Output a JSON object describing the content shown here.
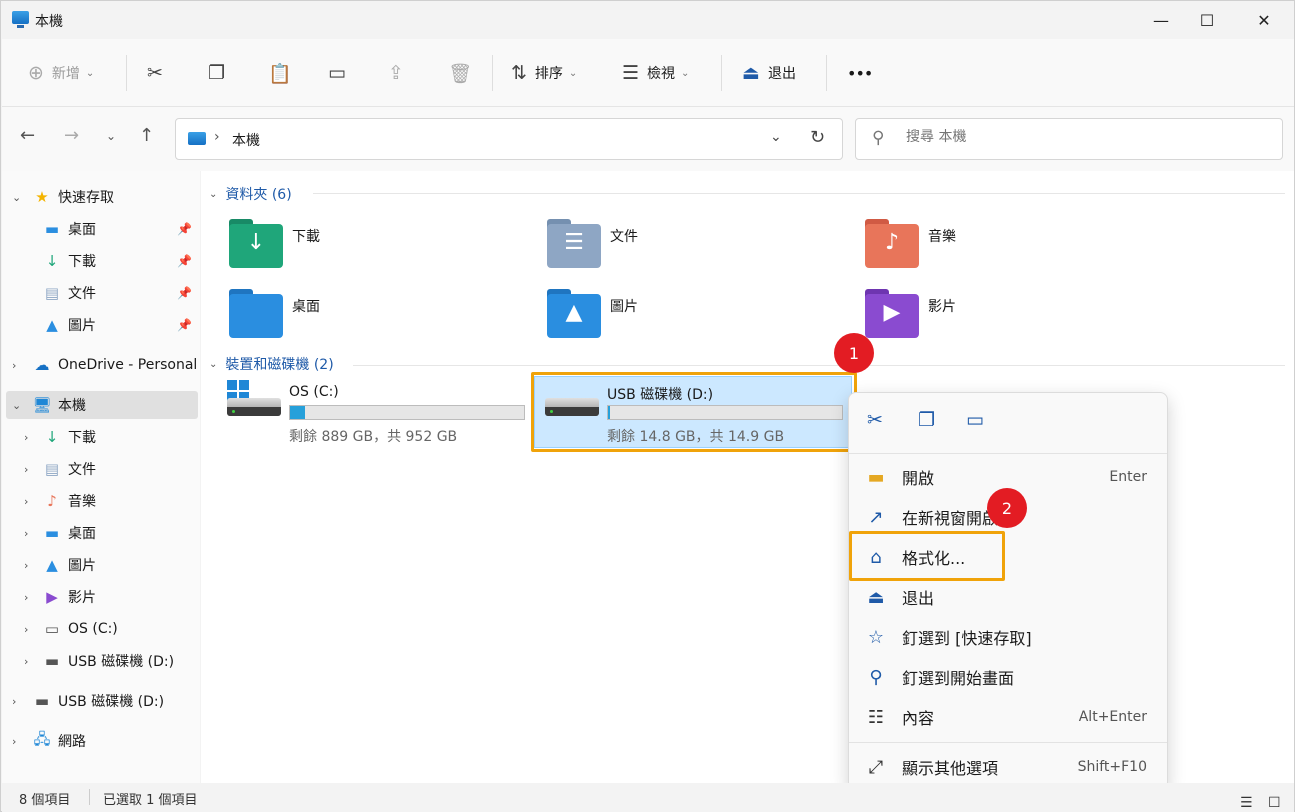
{
  "window": {
    "title": "本機",
    "min_icon": "minimize-icon",
    "max_icon": "maximize-icon",
    "close_icon": "close-icon"
  },
  "toolbar": {
    "new_label": "新增",
    "sort_label": "排序",
    "view_label": "檢視",
    "eject_label": "退出",
    "more_label": "•••"
  },
  "address": {
    "path": "本機"
  },
  "search": {
    "placeholder": "搜尋 本機"
  },
  "sidebar": {
    "items": [
      {
        "label": "快速存取"
      },
      {
        "label": "桌面"
      },
      {
        "label": "下載"
      },
      {
        "label": "文件"
      },
      {
        "label": "圖片"
      },
      {
        "label": "OneDrive - Personal"
      },
      {
        "label": "本機"
      },
      {
        "label": "下載"
      },
      {
        "label": "文件"
      },
      {
        "label": "音樂"
      },
      {
        "label": "桌面"
      },
      {
        "label": "圖片"
      },
      {
        "label": "影片"
      },
      {
        "label": "OS (C:)"
      },
      {
        "label": "USB 磁碟機 (D:)"
      },
      {
        "label": "USB 磁碟機 (D:)"
      },
      {
        "label": "網路"
      }
    ]
  },
  "main": {
    "folders_header": "資料夾 (6)",
    "folders": [
      {
        "name": "下載",
        "color": "#1fa67a"
      },
      {
        "name": "文件",
        "color": "#8ea6c4"
      },
      {
        "name": "音樂",
        "color": "#e8755a"
      },
      {
        "name": "桌面",
        "color": "#2a8ee0"
      },
      {
        "name": "圖片",
        "color": "#2a8ee0"
      },
      {
        "name": "影片",
        "color": "#8a4bd0"
      }
    ],
    "devices_header": "裝置和磁碟機 (2)",
    "drives": [
      {
        "name": "OS (C:)",
        "free": "剩餘 889 GB，共 952 GB",
        "used_fraction": 0.066
      },
      {
        "name": "USB 磁碟機 (D:)",
        "free": "剩餘 14.8 GB，共 14.9 GB",
        "used_fraction": 0.007
      }
    ]
  },
  "callouts": {
    "step1": "1",
    "step2": "2"
  },
  "context_menu": {
    "items": [
      {
        "label": "開啟",
        "key": "Enter"
      },
      {
        "label": "在新視窗開啟",
        "key": ""
      },
      {
        "label": "格式化...",
        "key": ""
      },
      {
        "label": "退出",
        "key": ""
      },
      {
        "label": "釘選到 [快速存取]",
        "key": ""
      },
      {
        "label": "釘選到開始畫面",
        "key": ""
      },
      {
        "label": "內容",
        "key": "Alt+Enter"
      },
      {
        "label": "顯示其他選項",
        "key": "Shift+F10"
      }
    ]
  },
  "status": {
    "count": "8 個項目",
    "selected": "已選取 1 個項目"
  },
  "colors": {
    "accent": "#1f5aa8",
    "highlight": "#f0a30a",
    "badge": "#e31c23",
    "selection": "#cce8ff"
  }
}
